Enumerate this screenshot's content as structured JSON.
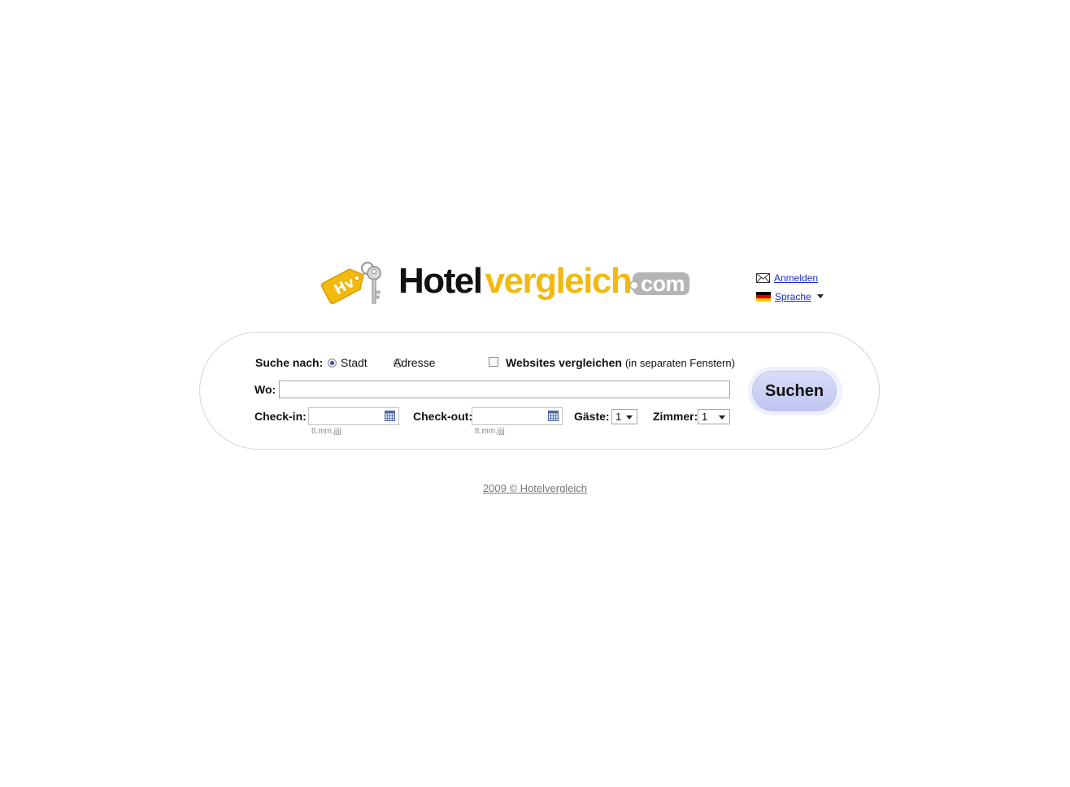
{
  "logo": {
    "text_primary": "Hotel",
    "text_accent": "vergleich",
    "text_suffix": "com",
    "tag_text": "Hv",
    "accent_color": "#f2b90f"
  },
  "toplinks": {
    "login_label": "Anmelden",
    "login_icon": "mail-icon",
    "language_label": "Sprache",
    "language_icon": "german-flag-icon"
  },
  "search": {
    "search_by_label": "Suche nach:",
    "options": [
      {
        "label": "Stadt",
        "selected": true
      },
      {
        "label": "Adresse",
        "selected": false
      }
    ],
    "compare_label": "Websites vergleichen",
    "compare_note": "(in separaten Fenstern)",
    "compare_checked": false,
    "where_label": "Wo:",
    "where_value": "",
    "checkin_label": "Check-in:",
    "checkin_value": "",
    "checkin_hint": "tt.mm.jjjj",
    "checkout_label": "Check-out:",
    "checkout_value": "",
    "checkout_hint": "tt.mm.jjjj",
    "guests_label": "Gäste:",
    "guests_value": "1",
    "rooms_label": "Zimmer:",
    "rooms_value": "1",
    "submit_label": "Suchen",
    "button_color": "#c8cdf3"
  },
  "footer": {
    "text": "2009 © Hotelvergleich"
  }
}
